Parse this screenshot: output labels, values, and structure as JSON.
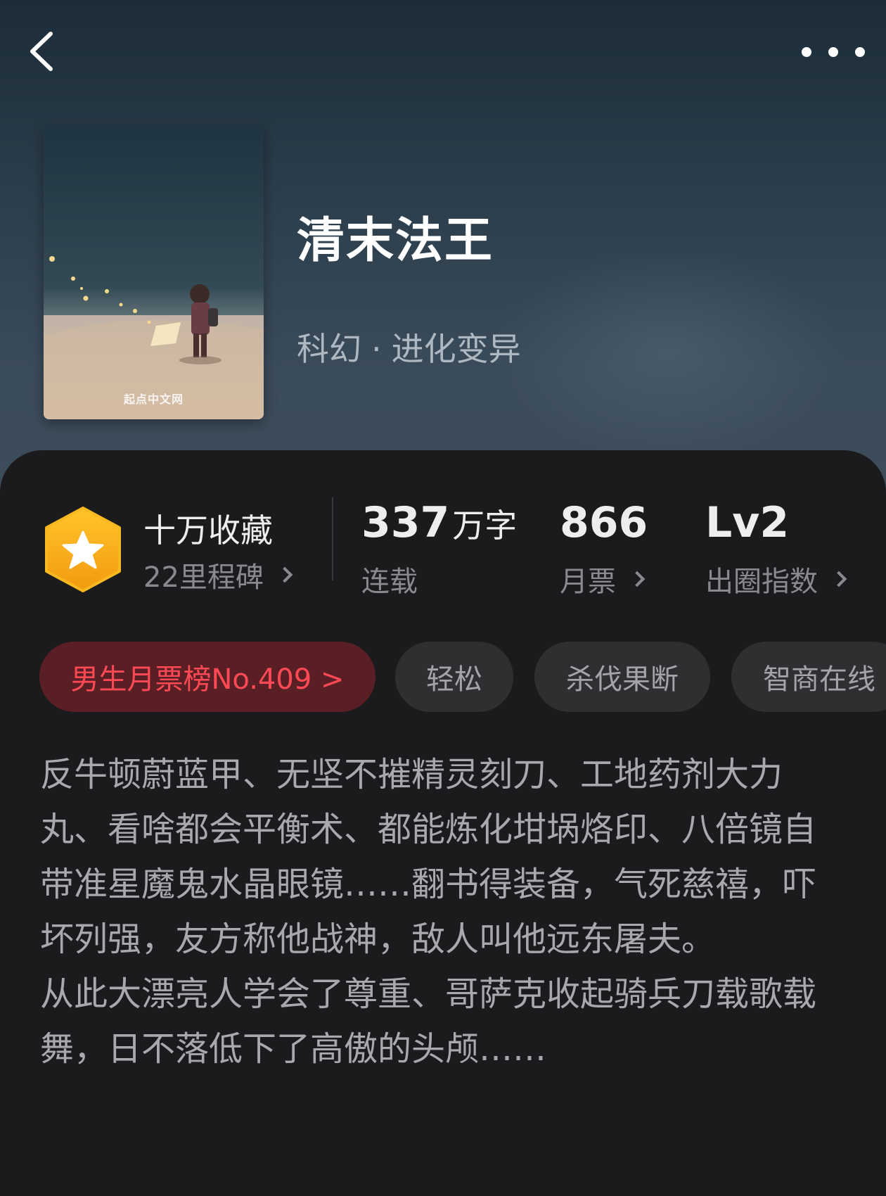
{
  "nav": {
    "back_icon": "chevron-left-icon",
    "more_icon": "more-horizontal-icon"
  },
  "book": {
    "title": "清末法王",
    "genre_main": "科幻",
    "genre_separator": "·",
    "genre_sub": "进化变异",
    "cover_watermark": "起点中文网"
  },
  "stats": {
    "collection": {
      "badge_icon": "star-hexagon-icon",
      "title": "十万收藏",
      "subtitle": "22里程碑"
    },
    "words": {
      "value": "337",
      "unit": "万字",
      "label": "连载"
    },
    "monthly_tickets": {
      "value": "866",
      "label": "月票"
    },
    "popularity": {
      "value": "Lv2",
      "label": "出圈指数"
    }
  },
  "tags": [
    {
      "label": "男生月票榜No.409 >",
      "style": "rank"
    },
    {
      "label": "轻松",
      "style": "plain"
    },
    {
      "label": "杀伐果断",
      "style": "plain"
    },
    {
      "label": "智商在线",
      "style": "plain"
    }
  ],
  "description": {
    "paragraphs": [
      "反牛顿蔚蓝甲、无坚不摧精灵刻刀、工地药剂大力丸、看啥都会平衡术、都能炼化坩埚烙印、八倍镜自带准星魔鬼水晶眼镜……翻书得装备，气死慈禧，吓坏列强，友方称他战神，敌人叫他远东屠夫。",
      "从此大漂亮人学会了尊重、哥萨克收起骑兵刀载歌载舞，日不落低下了高傲的头颅……"
    ]
  },
  "colors": {
    "rank_tag_bg": "#5a1f24",
    "rank_tag_text": "#ff4a55",
    "badge_gold": "#f7b21a",
    "card_bg": "#1b1b1d"
  }
}
